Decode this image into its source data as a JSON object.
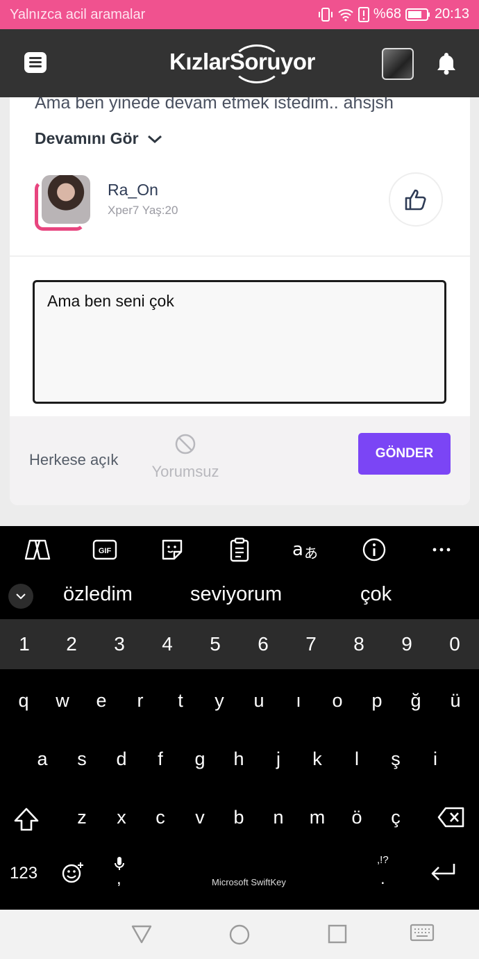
{
  "status_bar": {
    "carrier": "Yalnızca acil aramalar",
    "battery": "%68",
    "time": "20:13"
  },
  "header": {
    "logo_text": "KızlarSoruyor",
    "icons": [
      "menu-icon",
      "avatar",
      "bell-icon"
    ]
  },
  "answer": {
    "truncated_text": "Ama ben yinede devam etmek istedim.. ahsjsh",
    "show_more": "Devamını Gör",
    "user": {
      "name": "Ra_On",
      "meta": "Xper7 Yaş:20"
    }
  },
  "comment": {
    "value": "Ama ben seni çok"
  },
  "footer": {
    "visibility": "Herkese açık",
    "no_comment": "Yorumsuz",
    "send": "GÖNDER"
  },
  "keyboard": {
    "suggestions": [
      "özledim",
      "seviyorum",
      "çok"
    ],
    "numbers": [
      "1",
      "2",
      "3",
      "4",
      "5",
      "6",
      "7",
      "8",
      "9",
      "0"
    ],
    "row1": [
      "q",
      "w",
      "e",
      "r",
      "t",
      "y",
      "u",
      "ı",
      "o",
      "p",
      "ğ",
      "ü"
    ],
    "row2": [
      "a",
      "s",
      "d",
      "f",
      "g",
      "h",
      "j",
      "k",
      "l",
      "ş",
      "i"
    ],
    "row3": [
      "z",
      "x",
      "c",
      "v",
      "b",
      "n",
      "m",
      "ö",
      "ç"
    ],
    "numeric_key": "123",
    "comma": ",",
    "period": ".",
    "punct_hint": ",!?",
    "brand": "Microsoft SwiftKey"
  },
  "colors": {
    "status_bar": "#f0528f",
    "header": "#333333",
    "accent": "#7b45f5",
    "avatar_ring": "#e8457f"
  }
}
